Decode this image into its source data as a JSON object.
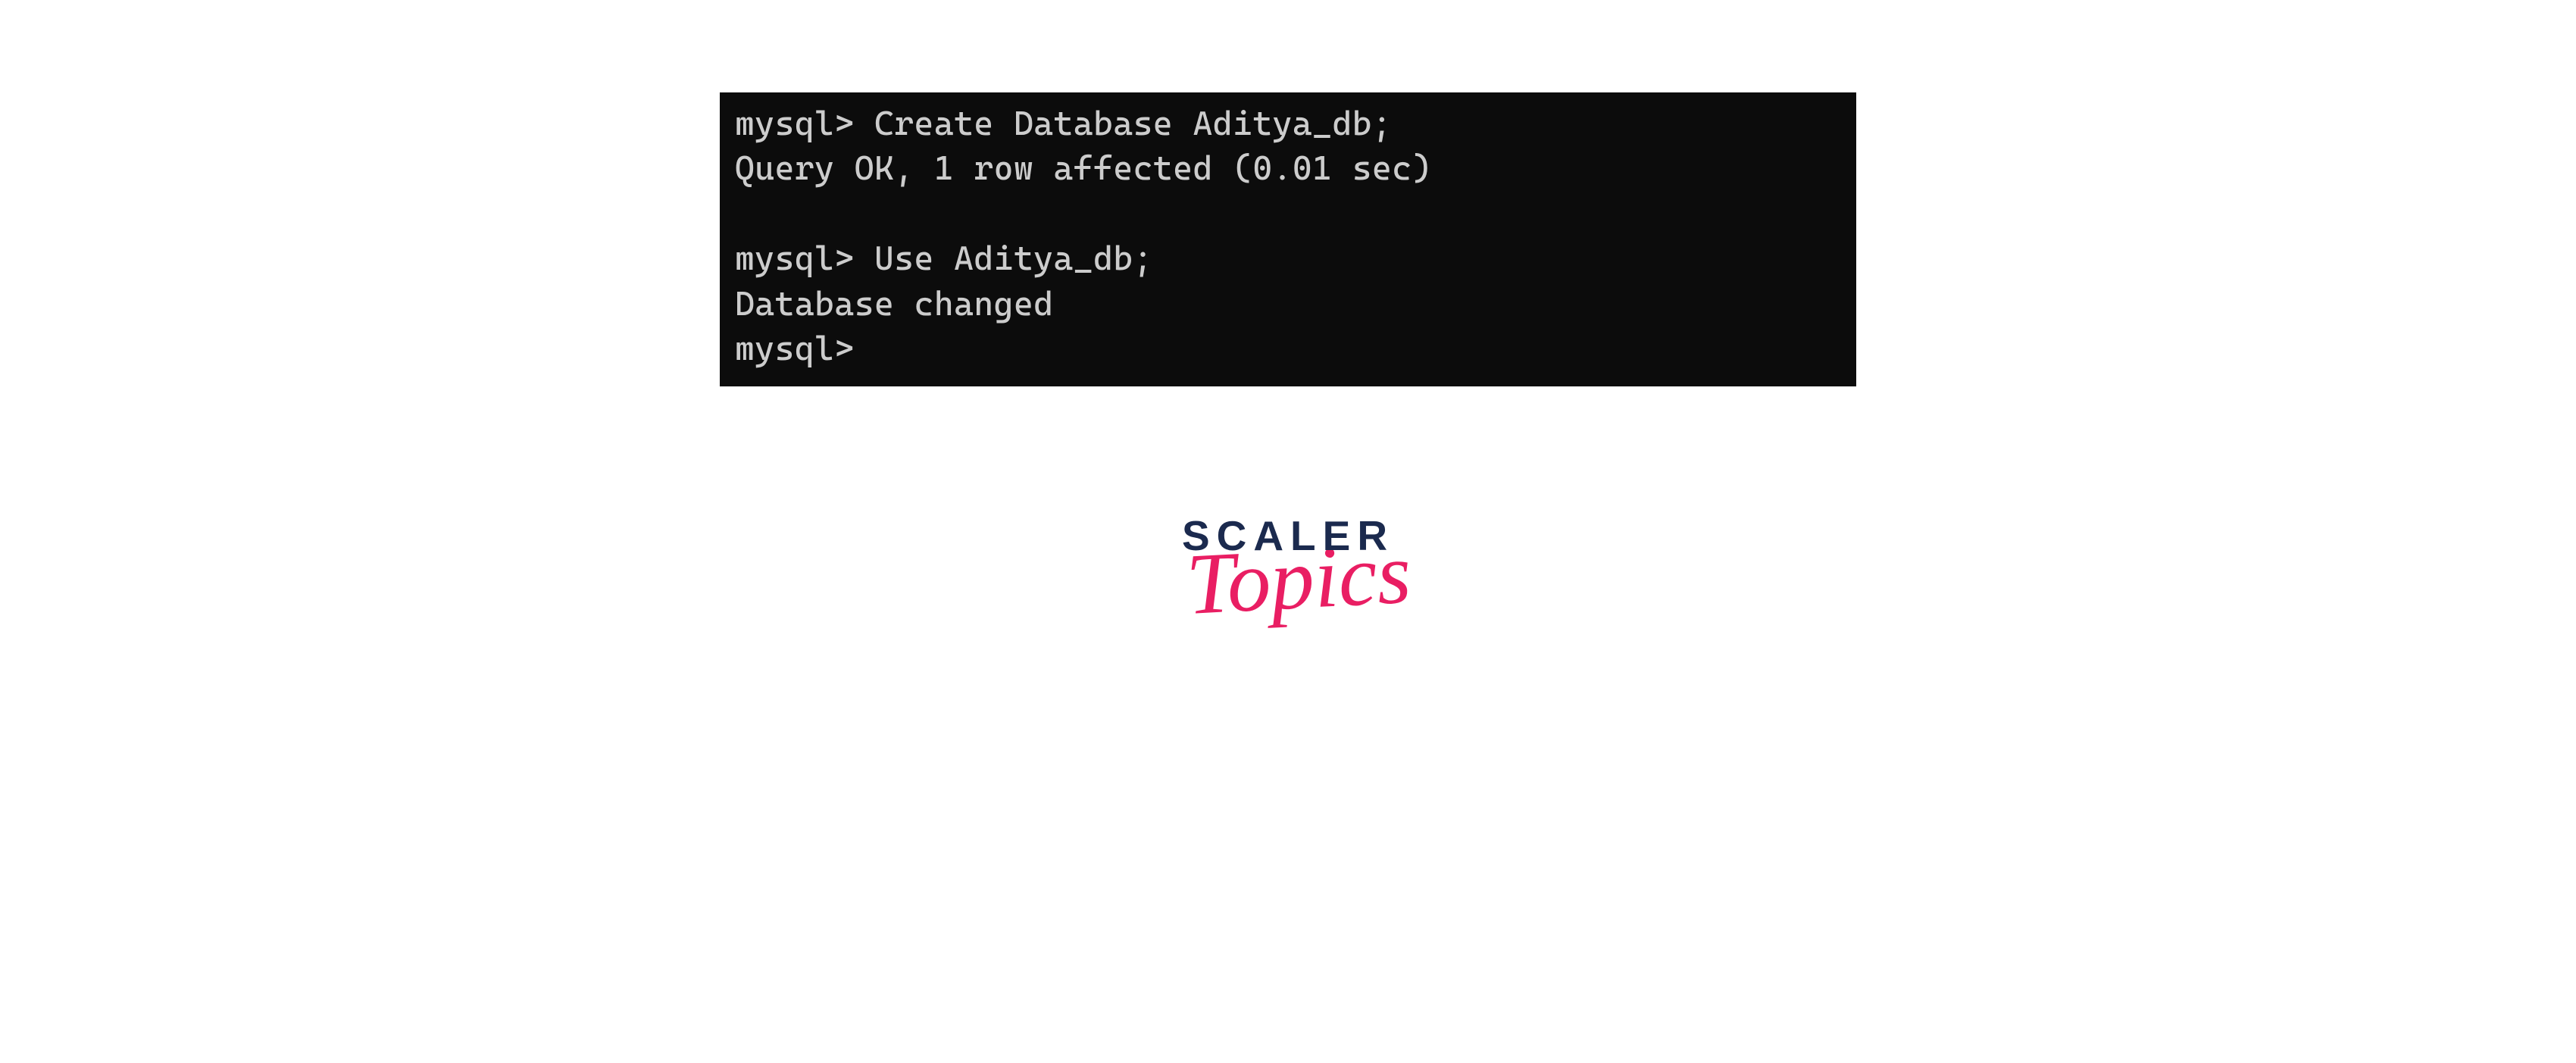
{
  "terminal": {
    "lines": [
      {
        "prompt": "mysql>",
        "command": "Create Database Aditya_db;"
      },
      {
        "output": "Query OK, 1 row affected (0.01 sec)"
      },
      {
        "output": ""
      },
      {
        "prompt": "mysql>",
        "command": "Use Aditya_db;"
      },
      {
        "output": "Database changed"
      },
      {
        "prompt": "mysql>",
        "command": ""
      }
    ]
  },
  "logo": {
    "top": "SCALER",
    "bottom": "Topics"
  }
}
